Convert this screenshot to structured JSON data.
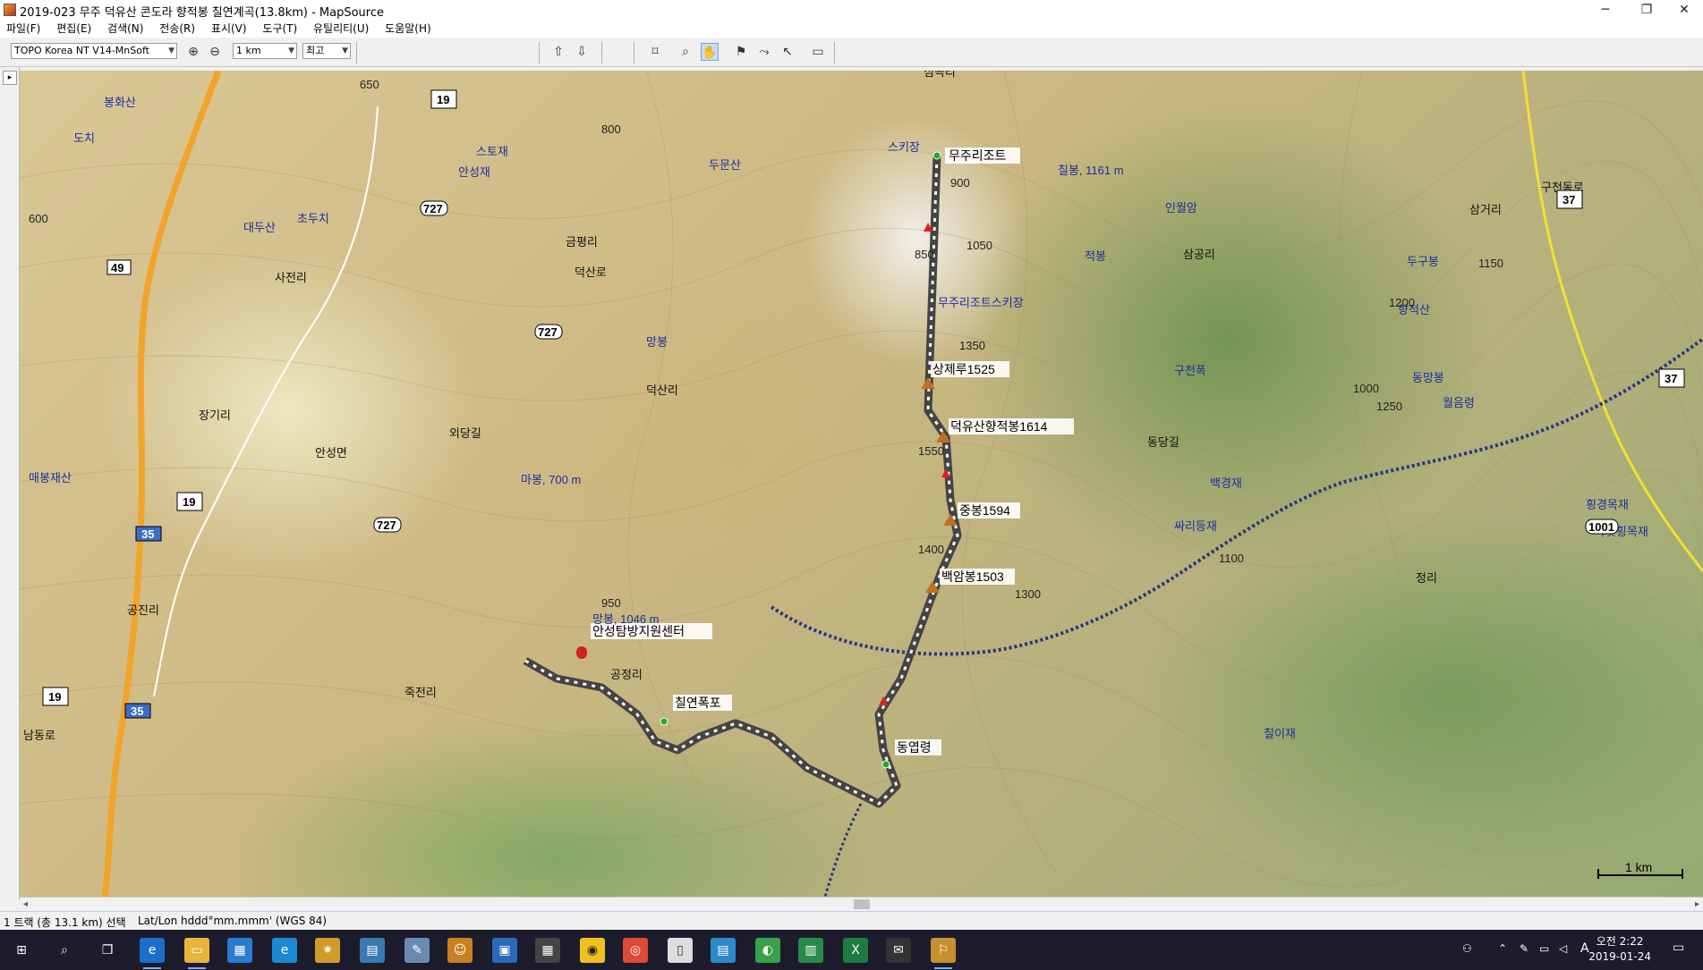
{
  "window": {
    "title": "2019-023 무주 덕유산 콘도라 향적봉 칠연계곡(13.8km) - MapSource",
    "minimize": "─",
    "maximize": "❐",
    "close": "✕"
  },
  "menu": [
    "파일(F)",
    "편집(E)",
    "검색(N)",
    "전송(R)",
    "표시(V)",
    "도구(T)",
    "유틸리티(U)",
    "도움말(H)"
  ],
  "toolbar": {
    "map_product": "TOPO Korea NT V14-MnSoft",
    "zoom_scale": "1 km",
    "detail": "최고"
  },
  "map": {
    "scale_bar_label": "1 km",
    "track_labels": [
      "무주리조트",
      "상제루1525",
      "덕유산향적봉1614",
      "중봉1594",
      "백암봉1503",
      "동엽령",
      "칠연폭포",
      "안성탐방지원센터"
    ],
    "place_labels": [
      "봉화산",
      "도치",
      "스토재",
      "안성재",
      "두문산",
      "대두산",
      "초두치",
      "금평리",
      "스키장",
      "칠봉, 1161 m",
      "인월암",
      "삼공리",
      "삼거리",
      "구천동로",
      "적봉",
      "두구봉",
      "향적산",
      "사전리",
      "무주리조트스키장",
      "망봉",
      "구천폭",
      "덕산리",
      "장기리",
      "안성면",
      "외당길",
      "매봉재산",
      "마봉, 700 m",
      "공정리",
      "동망봉",
      "월음령",
      "백경재",
      "싸리등재",
      "망봉, 1046 m",
      "공진리",
      "죽전리",
      "칠이재",
      "횡경목재",
      "아랫횡목재",
      "남동로",
      "정리",
      "심곡리",
      "덕산로",
      "동당길"
    ],
    "road_shields": [
      "19",
      "49",
      "727",
      "727",
      "19",
      "727",
      "35",
      "19",
      "35",
      "37",
      "37",
      "1001"
    ],
    "contour_labels": [
      "600",
      "650",
      "800",
      "850",
      "900",
      "950",
      "1000",
      "1050",
      "1100",
      "1150",
      "1200",
      "1250",
      "1300",
      "1350",
      "1400",
      "1550"
    ]
  },
  "status": {
    "selection": "1 트랙 (총 13.1 km) 선택",
    "coord_format": "Lat/Lon hddd°mm.mmm' (WGS 84)"
  },
  "taskbar": {
    "time": "오전 2:22",
    "date": "2019-01-24",
    "ime": "A"
  }
}
